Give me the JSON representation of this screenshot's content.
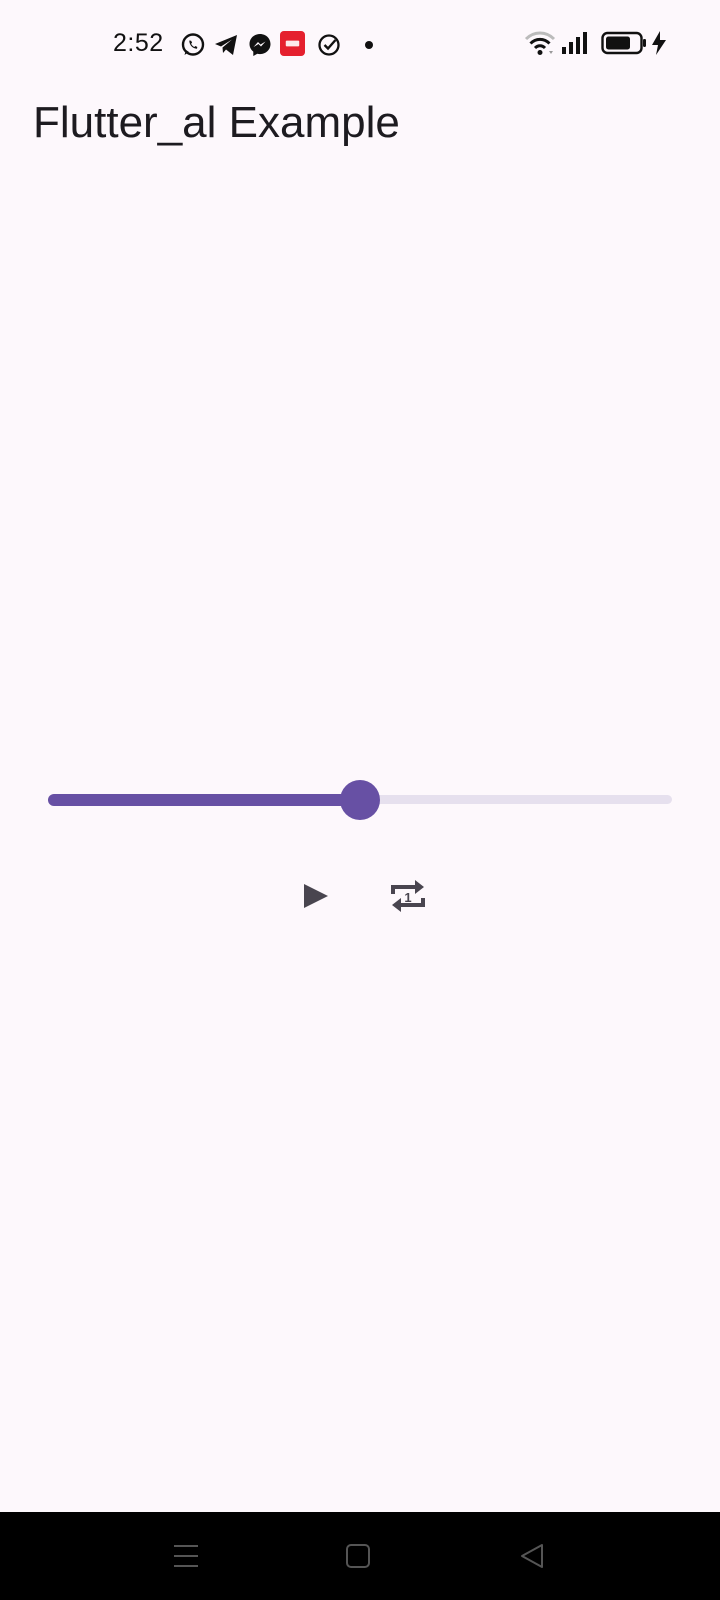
{
  "status_bar": {
    "time": "2:52",
    "notification_icons": [
      "whatsapp-icon",
      "telegram-icon",
      "messenger-icon",
      "red-app-icon",
      "check-circle-icon",
      "dot-icon"
    ],
    "system_icons": [
      "wifi-icon",
      "signal-icon",
      "battery-icon",
      "charging-icon"
    ]
  },
  "app_bar": {
    "title": "Flutter_al Example"
  },
  "player": {
    "progress": 0.5,
    "play_icon": "play-icon",
    "repeat_icon": "repeat-one-icon",
    "accent_color": "#6750a4",
    "inactive_track_color": "#e6e0ee"
  },
  "nav_bar": {
    "buttons": [
      "menu-icon",
      "home-icon",
      "back-icon"
    ]
  }
}
